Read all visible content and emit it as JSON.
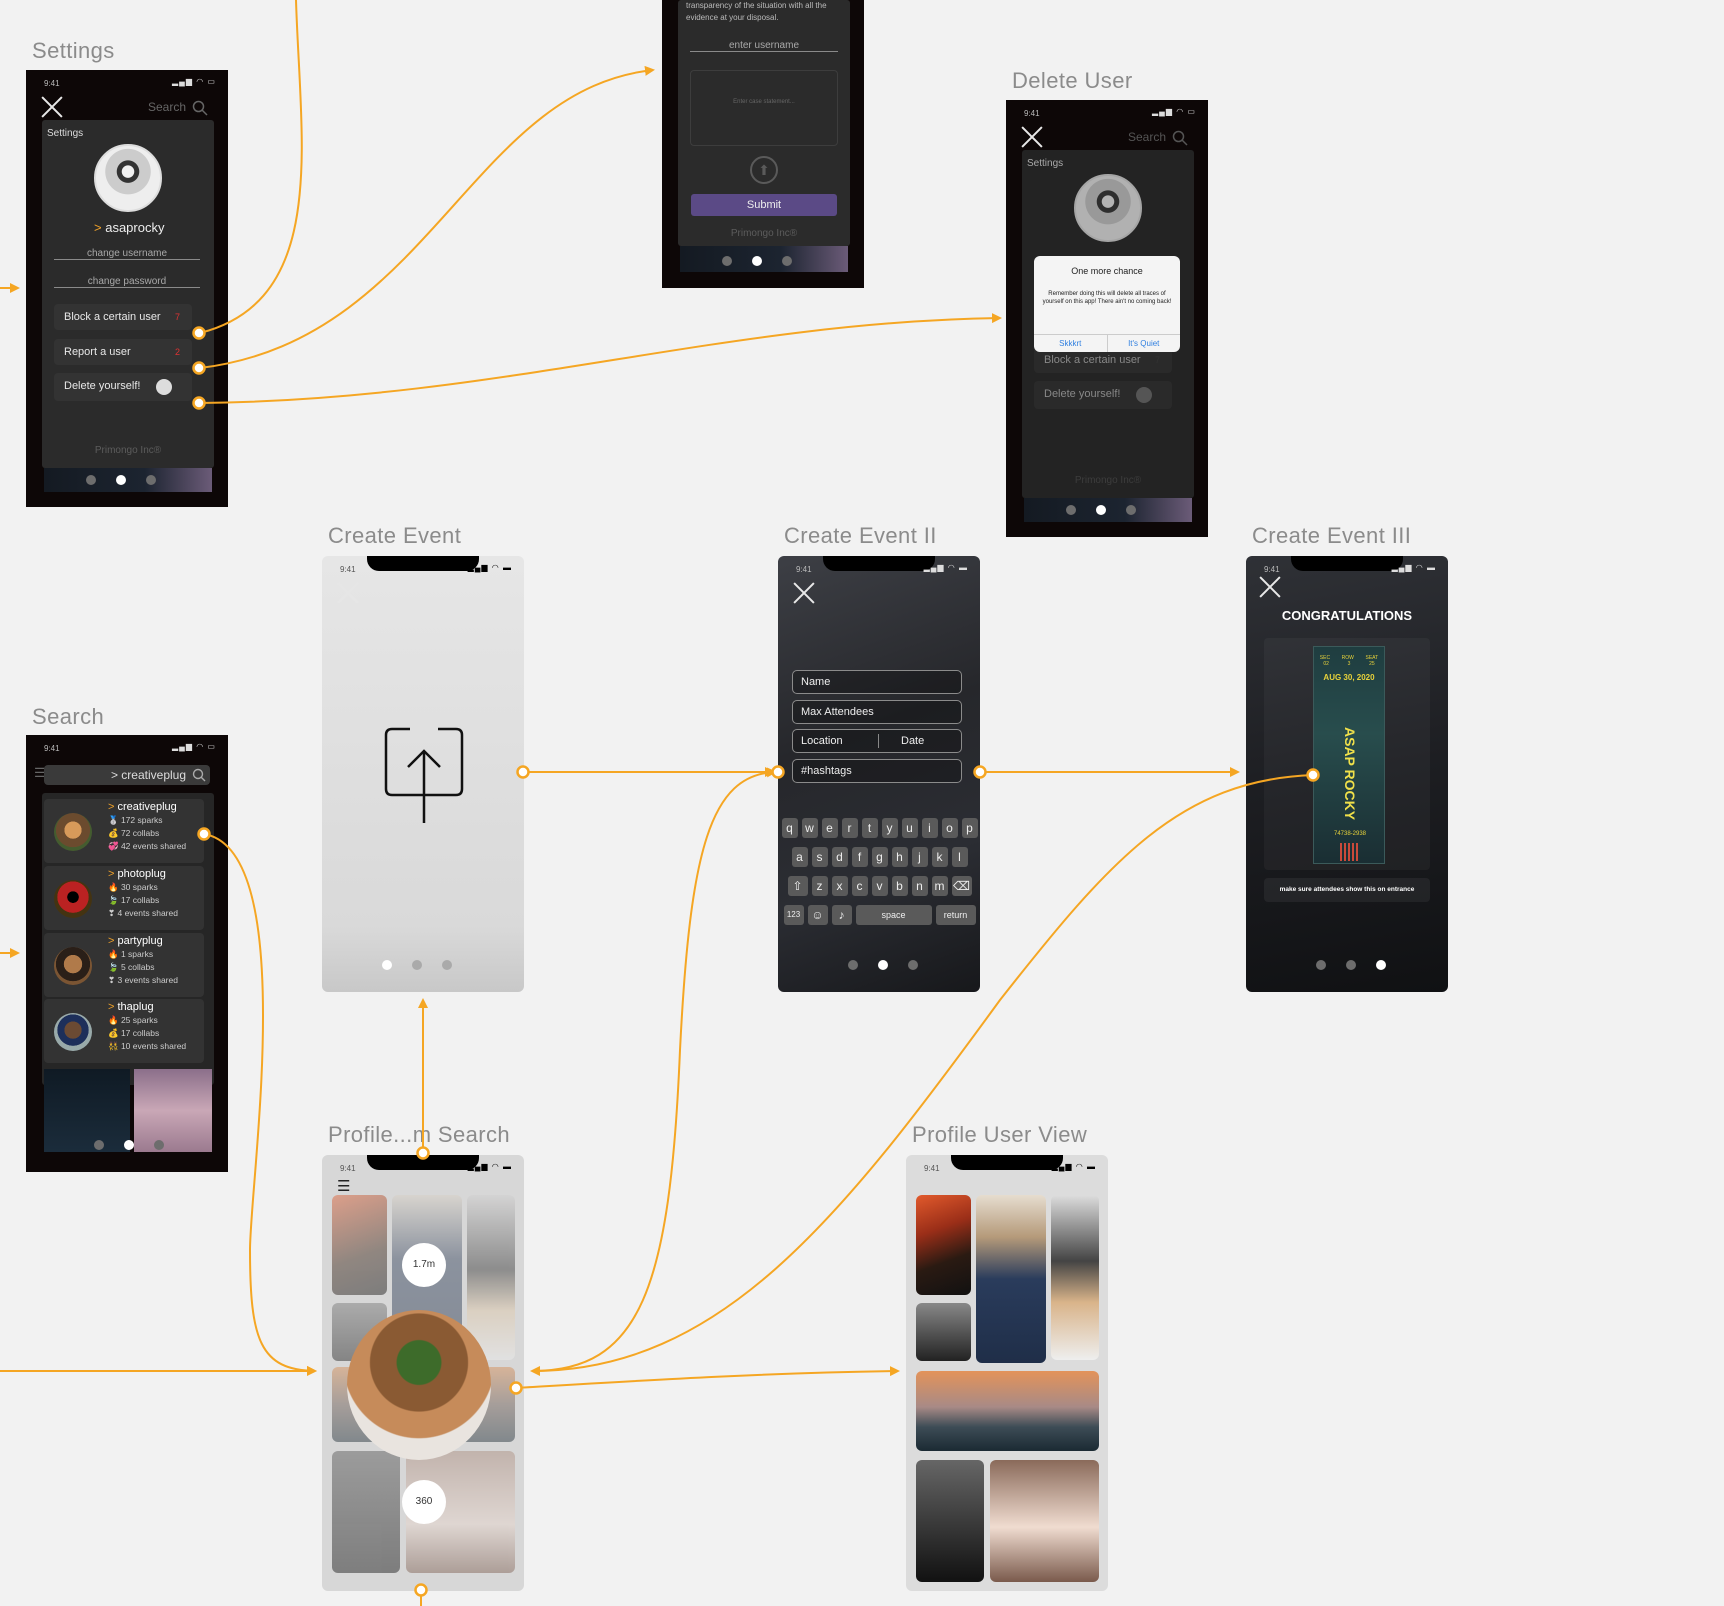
{
  "frames": {
    "settings": {
      "label": "Settings",
      "time": "9:41",
      "search": "Search",
      "header": "Settings",
      "username": "asaprocky",
      "username_prefix": ">",
      "change_username": "change username",
      "change_password": "change password",
      "block_user": "Block a certain user",
      "block_badge": "7",
      "report_user": "Report a user",
      "report_badge": "2",
      "delete_yourself": "Delete yourself!",
      "footer": "Primongo Inc®"
    },
    "report": {
      "intro_text": "transparency of the situation with all the evidence at your disposal.",
      "username_placeholder": "enter username",
      "case_placeholder": "Enter case statement...",
      "submit": "Submit",
      "footer": "Primongo Inc®"
    },
    "delete_user": {
      "label": "Delete User",
      "time": "9:41",
      "search": "Search",
      "header": "Settings",
      "dialog_title": "One more chance",
      "dialog_body": "Remember doing this will delete all traces of yourself on this app! There ain't no coming back!",
      "dialog_cancel": "Skkkrt",
      "dialog_confirm": "It's Quiet",
      "block_user": "Block a certain user",
      "block_badge": "7",
      "delete_yourself": "Delete yourself!",
      "footer": "Primongo Inc®"
    },
    "create_event": {
      "label": "Create Event",
      "time": "9:41"
    },
    "create_event_2": {
      "label": "Create Event II",
      "time": "9:41",
      "name": "Name",
      "max_attendees": "Max Attendees",
      "location": "Location",
      "date": "Date",
      "hashtags": "#hashtags",
      "keys_row1": [
        "q",
        "w",
        "e",
        "r",
        "t",
        "y",
        "u",
        "i",
        "o",
        "p"
      ],
      "keys_row2": [
        "a",
        "s",
        "d",
        "f",
        "g",
        "h",
        "j",
        "k",
        "l"
      ],
      "keys_row3": [
        "z",
        "x",
        "c",
        "v",
        "b",
        "n",
        "m"
      ],
      "key_123": "123",
      "key_space": "space",
      "key_return": "return"
    },
    "create_event_3": {
      "label": "Create Event III",
      "time": "9:41",
      "title": "CONGRATULATIONS",
      "ticket_name": "ASAP ROCKY",
      "ticket_date": "AUG 30, 2020",
      "ticket_sec": "SEC",
      "ticket_row": "ROW",
      "ticket_seat": "SEAT",
      "ticket_sec_v": "02",
      "ticket_row_v": "3",
      "ticket_seat_v": "25",
      "ticket_code": "74738-2938",
      "note": "make sure attendees show this on entrance"
    },
    "search": {
      "label": "Search",
      "time": "9:41",
      "query": "> creativeplug",
      "results": [
        {
          "name": "creativeplug",
          "sparks": "172 sparks",
          "collabs": "72 collabs",
          "events": "42 events shared"
        },
        {
          "name": "photoplug",
          "sparks": "30 sparks",
          "collabs": "17 collabs",
          "events": "4 events shared"
        },
        {
          "name": "partyplug",
          "sparks": "1 sparks",
          "collabs": "5 collabs",
          "events": "3 events shared"
        },
        {
          "name": "thaplug",
          "sparks": "25 sparks",
          "collabs": "17 collabs",
          "events": "10 events shared"
        }
      ]
    },
    "profile_search": {
      "label": "Profile...m Search",
      "time": "9:41",
      "count_top": "1.7m",
      "count_bottom": "360"
    },
    "profile_user": {
      "label": "Profile User View",
      "time": "9:41"
    }
  },
  "colors": {
    "canvas": "#f2f2f2",
    "connector": "#f5a623",
    "accent_purple": "#5b4a86",
    "dialog_blue": "#2f7fe0"
  },
  "icons": [
    "close-icon",
    "search-icon",
    "upload-icon",
    "menu-icon",
    "arrow-up-icon",
    "backspace-icon",
    "shift-icon",
    "emoji-icon",
    "mic-icon"
  ]
}
